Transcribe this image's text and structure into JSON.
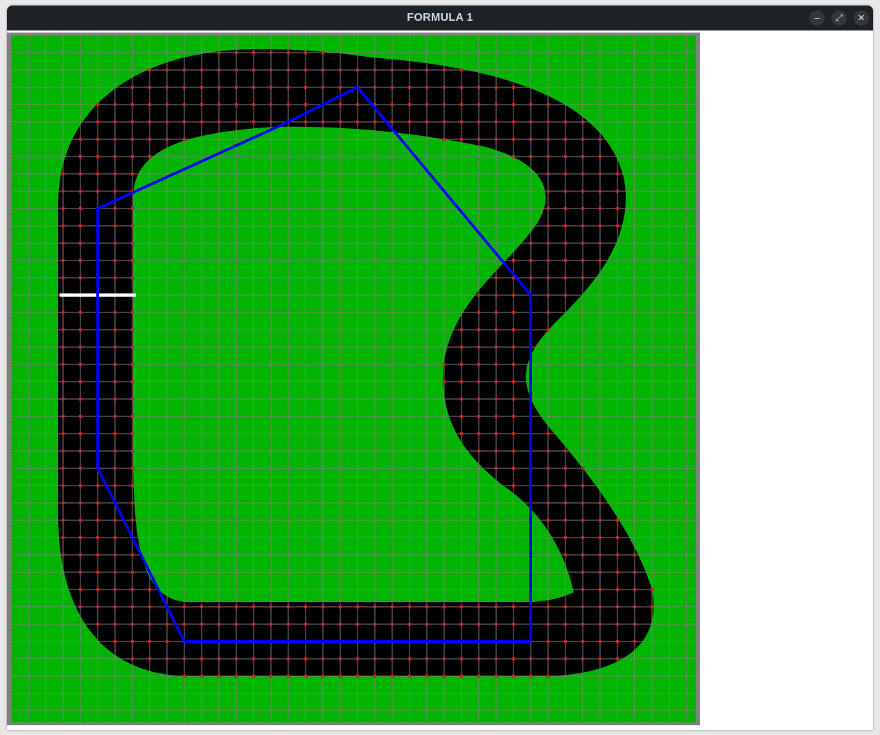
{
  "window": {
    "title": "FORMULA 1",
    "buttons": {
      "minimize_icon": "minimize-icon",
      "maximize_icon": "maximize-icon",
      "close_icon": "close-icon"
    }
  },
  "game": {
    "colors": {
      "titlebar": "#1e2227",
      "frame": "#808080",
      "grass": "#00b400",
      "track": "#000000",
      "grid": "#808080",
      "node": "#cc2222",
      "path": "#0000ff",
      "start_line": "#ffffff"
    },
    "grid_step": 25,
    "start_line": {
      "col": [
        3,
        7
      ],
      "row": 15
    },
    "path_vertices": [
      [
        5,
        15
      ],
      [
        5,
        10
      ],
      [
        16,
        5
      ],
      [
        20,
        3
      ],
      [
        30,
        15
      ],
      [
        30,
        35
      ],
      [
        10,
        35
      ],
      [
        5,
        25
      ],
      [
        5,
        15
      ]
    ]
  }
}
